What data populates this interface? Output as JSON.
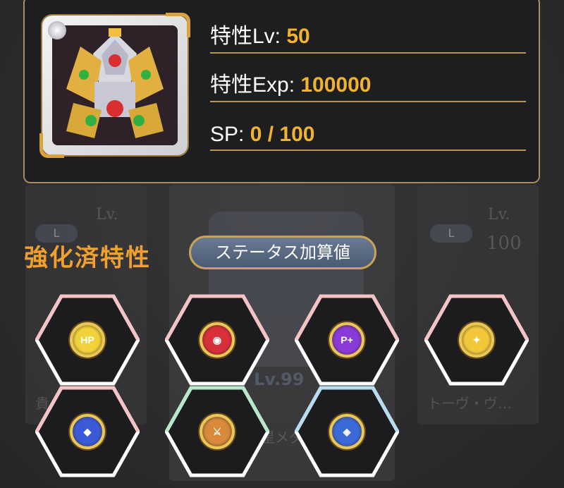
{
  "stats": {
    "level_label": "特性Lv: ",
    "level_value": "50",
    "exp_label": "特性Exp: ",
    "exp_value": "100000",
    "sp_label": "SP: ",
    "sp_value": "0 / 100"
  },
  "section": {
    "title": "強化済特性",
    "status_button": "ステータス加算値"
  },
  "background": {
    "lv_text": "Lv.",
    "lv_text_2": "Lv.",
    "lv_number": "100",
    "lv99": "Lv.99",
    "rarity": "L",
    "rarity_2": "L",
    "name_right": "トーヴ・ヴ…",
    "name_left": "貴",
    "name_mid": "星メダ"
  },
  "traits": [
    {
      "icon": "hp-icon",
      "symbol": "HP",
      "border": "#f4c4c4",
      "medal": "#f2d23a"
    },
    {
      "icon": "eye-icon",
      "symbol": "◉",
      "border": "#f4c4c4",
      "medal": "#d8303a"
    },
    {
      "icon": "p-plus-icon",
      "symbol": "P+",
      "border": "#f4c4c4",
      "medal": "#8a3ad8"
    },
    {
      "icon": "attack-icon",
      "symbol": "✦",
      "border": "#f4c4c4",
      "medal": "#f2c83a"
    },
    {
      "icon": "water-shield-icon",
      "symbol": "◆",
      "border": "#f4c4c4",
      "medal": "#3a5ad8"
    },
    {
      "icon": "sword-shield-icon",
      "symbol": "⚔",
      "border": "#b8e8c8",
      "medal": "#d88a3a"
    },
    {
      "icon": "magic-shield-icon",
      "symbol": "◈",
      "border": "#b8dcf0",
      "medal": "#3a6ad8"
    }
  ]
}
